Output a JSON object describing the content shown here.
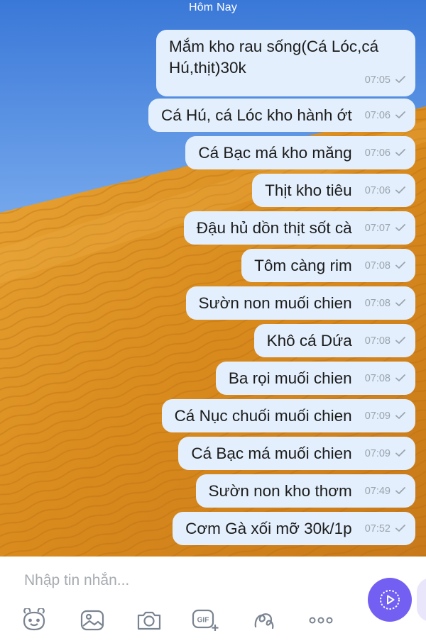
{
  "chat": {
    "day_label": "Hôm Nay",
    "messages": [
      {
        "text": "Mắm kho rau sống(Cá Lóc,cá Hú,thịt)30k",
        "time": "07:05"
      },
      {
        "text": "Cá Hú, cá Lóc kho hành ớt",
        "time": "07:06"
      },
      {
        "text": "Cá Bạc má kho măng",
        "time": "07:06"
      },
      {
        "text": "Thịt kho tiêu",
        "time": "07:06"
      },
      {
        "text": "Đậu hủ dồn thịt sốt cà",
        "time": "07:07"
      },
      {
        "text": "Tôm càng rim",
        "time": "07:08"
      },
      {
        "text": "Sườn non muối chien",
        "time": "07:08"
      },
      {
        "text": "Khô cá Dứa",
        "time": "07:08"
      },
      {
        "text": "Ba rọi muối chien",
        "time": "07:08"
      },
      {
        "text": "Cá Nục chuối muối chien",
        "time": "07:09"
      },
      {
        "text": "Cá Bạc má muối chien",
        "time": "07:09"
      },
      {
        "text": "Sườn non kho thơm",
        "time": "07:49"
      },
      {
        "text": "Cơm Gà xối mỡ 30k/1p",
        "time": "07:52"
      }
    ]
  },
  "composer": {
    "placeholder": "Nhập tin nhắn...",
    "tools": [
      "sticker-icon",
      "gallery-icon",
      "camera-icon",
      "gif-icon",
      "doodle-icon",
      "more-icon"
    ],
    "send_icon": "send-video-icon"
  },
  "colors": {
    "bubble": "#e3effc",
    "accent": "#7360f2",
    "sand": "#d88c1c"
  }
}
